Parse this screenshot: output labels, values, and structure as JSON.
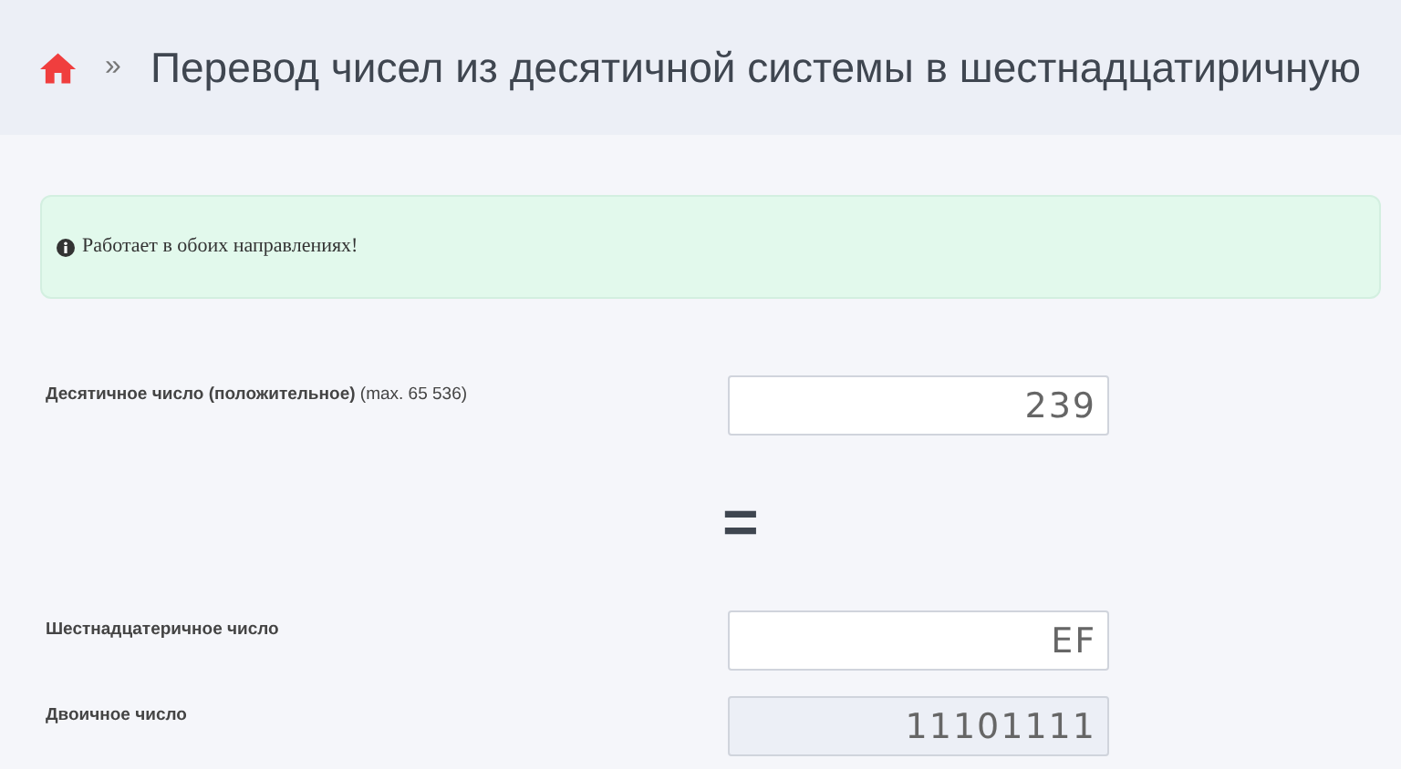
{
  "breadcrumb": {
    "separator": "»",
    "title": "Перевод чисел из десятичной системы в шестнадцатиричную"
  },
  "alert": {
    "text": "Работает в обоих направлениях!"
  },
  "fields": [
    {
      "kind": "field",
      "label": "**Десятичное число (положительное)** (max. 65 536)",
      "value": "239",
      "disabled": false
    },
    {
      "kind": "equals",
      "symbol": "="
    },
    {
      "kind": "field",
      "label": "**Шестнадцатеричное число**",
      "value": "EF",
      "disabled": false
    },
    {
      "kind": "field",
      "label": "**Двоичное число**",
      "value": "11101111",
      "disabled": true
    }
  ]
}
